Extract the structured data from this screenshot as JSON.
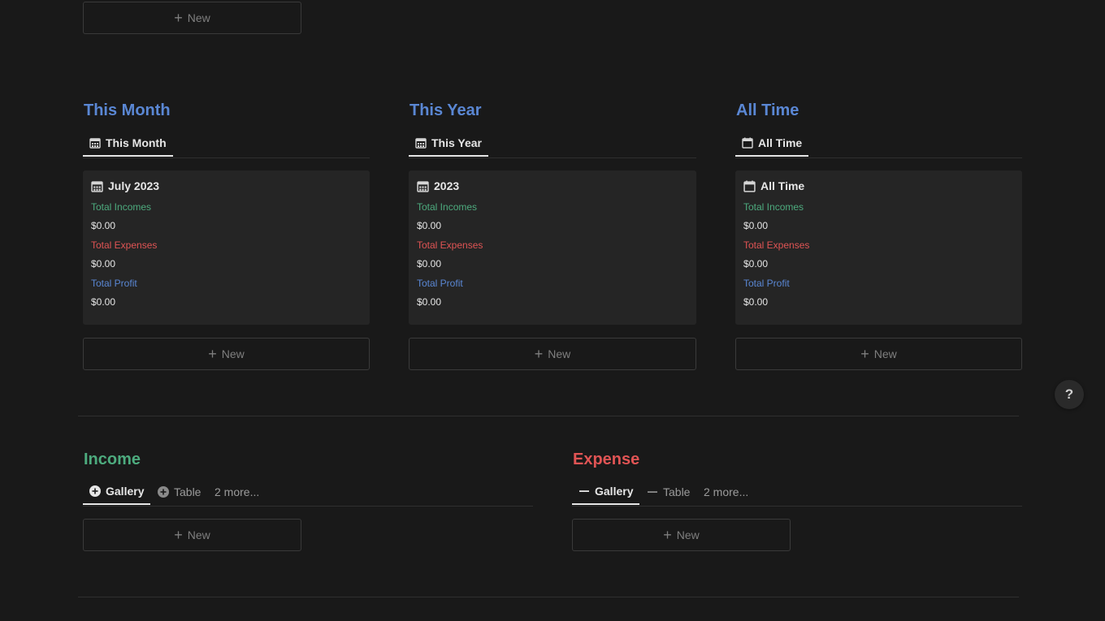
{
  "top": {
    "new_label": "New"
  },
  "summary": [
    {
      "title": "This Month",
      "tab_label": "This Month",
      "card": {
        "title": "July 2023",
        "incomes_label": "Total Incomes",
        "incomes_value": "$0.00",
        "expenses_label": "Total Expenses",
        "expenses_value": "$0.00",
        "profit_label": "Total Profit",
        "profit_value": "$0.00"
      },
      "new_label": "New"
    },
    {
      "title": "This Year",
      "tab_label": "This Year",
      "card": {
        "title": "2023",
        "incomes_label": "Total Incomes",
        "incomes_value": "$0.00",
        "expenses_label": "Total Expenses",
        "expenses_value": "$0.00",
        "profit_label": "Total Profit",
        "profit_value": "$0.00"
      },
      "new_label": "New"
    },
    {
      "title": "All Time",
      "tab_label": "All Time",
      "card": {
        "title": "All Time",
        "incomes_label": "Total Incomes",
        "incomes_value": "$0.00",
        "expenses_label": "Total Expenses",
        "expenses_value": "$0.00",
        "profit_label": "Total Profit",
        "profit_value": "$0.00"
      },
      "new_label": "New"
    }
  ],
  "income": {
    "title": "Income",
    "tabs": [
      {
        "label": "Gallery"
      },
      {
        "label": "Table"
      }
    ],
    "more_label": "2 more...",
    "new_label": "New"
  },
  "expense": {
    "title": "Expense",
    "tabs": [
      {
        "label": "Gallery"
      },
      {
        "label": "Table"
      }
    ],
    "more_label": "2 more...",
    "new_label": "New"
  },
  "help": {
    "label": "?"
  },
  "colors": {
    "background": "#191919",
    "card": "#252525",
    "income_green": "#4dab7e",
    "expense_red": "#e05454",
    "profit_blue": "#5a87d4"
  },
  "icons": {
    "calendar_month": "calendar-grid-icon",
    "calendar_all": "calendar-icon",
    "income_tab": "plus-circle-icon",
    "expense_tab": "minus-icon"
  }
}
